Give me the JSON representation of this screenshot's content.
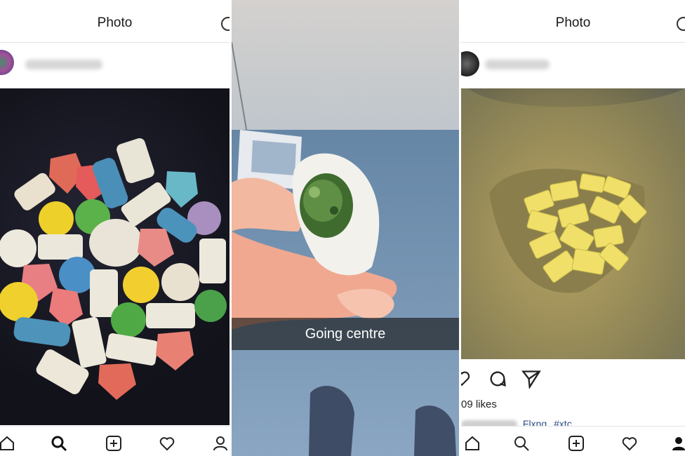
{
  "left_panel": {
    "header": {
      "title": "Photo"
    },
    "nav_icons": [
      "home-icon",
      "search-icon",
      "add-icon",
      "heart-icon",
      "profile-icon"
    ]
  },
  "middle_panel": {
    "caption": "Going centre"
  },
  "right_panel": {
    "header": {
      "title": "Photo"
    },
    "action_icons": [
      "comment-icon",
      "send-icon"
    ],
    "likes_text": "09 likes",
    "caption_text": "Flxng",
    "hashtag": "#xtc",
    "nav_icons": [
      "home-icon",
      "search-icon",
      "add-icon",
      "heart-icon",
      "profile-icon"
    ]
  },
  "colors": {
    "link": "#2f4f88",
    "caption_bg": "#1a1a1a",
    "divider": "#ffffff"
  }
}
